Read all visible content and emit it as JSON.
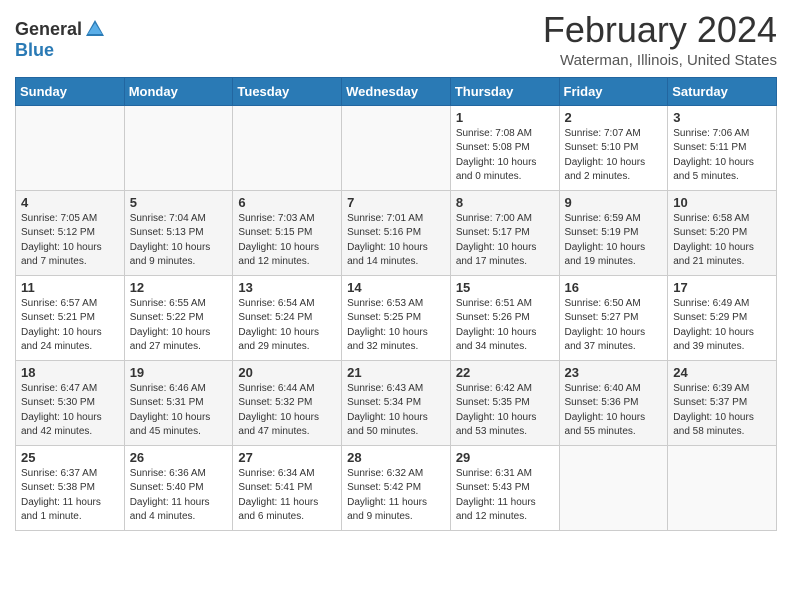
{
  "header": {
    "logo_general": "General",
    "logo_blue": "Blue",
    "month_title": "February 2024",
    "location": "Waterman, Illinois, United States"
  },
  "weekdays": [
    "Sunday",
    "Monday",
    "Tuesday",
    "Wednesday",
    "Thursday",
    "Friday",
    "Saturday"
  ],
  "weeks": [
    [
      {
        "day": "",
        "info": ""
      },
      {
        "day": "",
        "info": ""
      },
      {
        "day": "",
        "info": ""
      },
      {
        "day": "",
        "info": ""
      },
      {
        "day": "1",
        "info": "Sunrise: 7:08 AM\nSunset: 5:08 PM\nDaylight: 10 hours\nand 0 minutes."
      },
      {
        "day": "2",
        "info": "Sunrise: 7:07 AM\nSunset: 5:10 PM\nDaylight: 10 hours\nand 2 minutes."
      },
      {
        "day": "3",
        "info": "Sunrise: 7:06 AM\nSunset: 5:11 PM\nDaylight: 10 hours\nand 5 minutes."
      }
    ],
    [
      {
        "day": "4",
        "info": "Sunrise: 7:05 AM\nSunset: 5:12 PM\nDaylight: 10 hours\nand 7 minutes."
      },
      {
        "day": "5",
        "info": "Sunrise: 7:04 AM\nSunset: 5:13 PM\nDaylight: 10 hours\nand 9 minutes."
      },
      {
        "day": "6",
        "info": "Sunrise: 7:03 AM\nSunset: 5:15 PM\nDaylight: 10 hours\nand 12 minutes."
      },
      {
        "day": "7",
        "info": "Sunrise: 7:01 AM\nSunset: 5:16 PM\nDaylight: 10 hours\nand 14 minutes."
      },
      {
        "day": "8",
        "info": "Sunrise: 7:00 AM\nSunset: 5:17 PM\nDaylight: 10 hours\nand 17 minutes."
      },
      {
        "day": "9",
        "info": "Sunrise: 6:59 AM\nSunset: 5:19 PM\nDaylight: 10 hours\nand 19 minutes."
      },
      {
        "day": "10",
        "info": "Sunrise: 6:58 AM\nSunset: 5:20 PM\nDaylight: 10 hours\nand 21 minutes."
      }
    ],
    [
      {
        "day": "11",
        "info": "Sunrise: 6:57 AM\nSunset: 5:21 PM\nDaylight: 10 hours\nand 24 minutes."
      },
      {
        "day": "12",
        "info": "Sunrise: 6:55 AM\nSunset: 5:22 PM\nDaylight: 10 hours\nand 27 minutes."
      },
      {
        "day": "13",
        "info": "Sunrise: 6:54 AM\nSunset: 5:24 PM\nDaylight: 10 hours\nand 29 minutes."
      },
      {
        "day": "14",
        "info": "Sunrise: 6:53 AM\nSunset: 5:25 PM\nDaylight: 10 hours\nand 32 minutes."
      },
      {
        "day": "15",
        "info": "Sunrise: 6:51 AM\nSunset: 5:26 PM\nDaylight: 10 hours\nand 34 minutes."
      },
      {
        "day": "16",
        "info": "Sunrise: 6:50 AM\nSunset: 5:27 PM\nDaylight: 10 hours\nand 37 minutes."
      },
      {
        "day": "17",
        "info": "Sunrise: 6:49 AM\nSunset: 5:29 PM\nDaylight: 10 hours\nand 39 minutes."
      }
    ],
    [
      {
        "day": "18",
        "info": "Sunrise: 6:47 AM\nSunset: 5:30 PM\nDaylight: 10 hours\nand 42 minutes."
      },
      {
        "day": "19",
        "info": "Sunrise: 6:46 AM\nSunset: 5:31 PM\nDaylight: 10 hours\nand 45 minutes."
      },
      {
        "day": "20",
        "info": "Sunrise: 6:44 AM\nSunset: 5:32 PM\nDaylight: 10 hours\nand 47 minutes."
      },
      {
        "day": "21",
        "info": "Sunrise: 6:43 AM\nSunset: 5:34 PM\nDaylight: 10 hours\nand 50 minutes."
      },
      {
        "day": "22",
        "info": "Sunrise: 6:42 AM\nSunset: 5:35 PM\nDaylight: 10 hours\nand 53 minutes."
      },
      {
        "day": "23",
        "info": "Sunrise: 6:40 AM\nSunset: 5:36 PM\nDaylight: 10 hours\nand 55 minutes."
      },
      {
        "day": "24",
        "info": "Sunrise: 6:39 AM\nSunset: 5:37 PM\nDaylight: 10 hours\nand 58 minutes."
      }
    ],
    [
      {
        "day": "25",
        "info": "Sunrise: 6:37 AM\nSunset: 5:38 PM\nDaylight: 11 hours\nand 1 minute."
      },
      {
        "day": "26",
        "info": "Sunrise: 6:36 AM\nSunset: 5:40 PM\nDaylight: 11 hours\nand 4 minutes."
      },
      {
        "day": "27",
        "info": "Sunrise: 6:34 AM\nSunset: 5:41 PM\nDaylight: 11 hours\nand 6 minutes."
      },
      {
        "day": "28",
        "info": "Sunrise: 6:32 AM\nSunset: 5:42 PM\nDaylight: 11 hours\nand 9 minutes."
      },
      {
        "day": "29",
        "info": "Sunrise: 6:31 AM\nSunset: 5:43 PM\nDaylight: 11 hours\nand 12 minutes."
      },
      {
        "day": "",
        "info": ""
      },
      {
        "day": "",
        "info": ""
      }
    ]
  ]
}
